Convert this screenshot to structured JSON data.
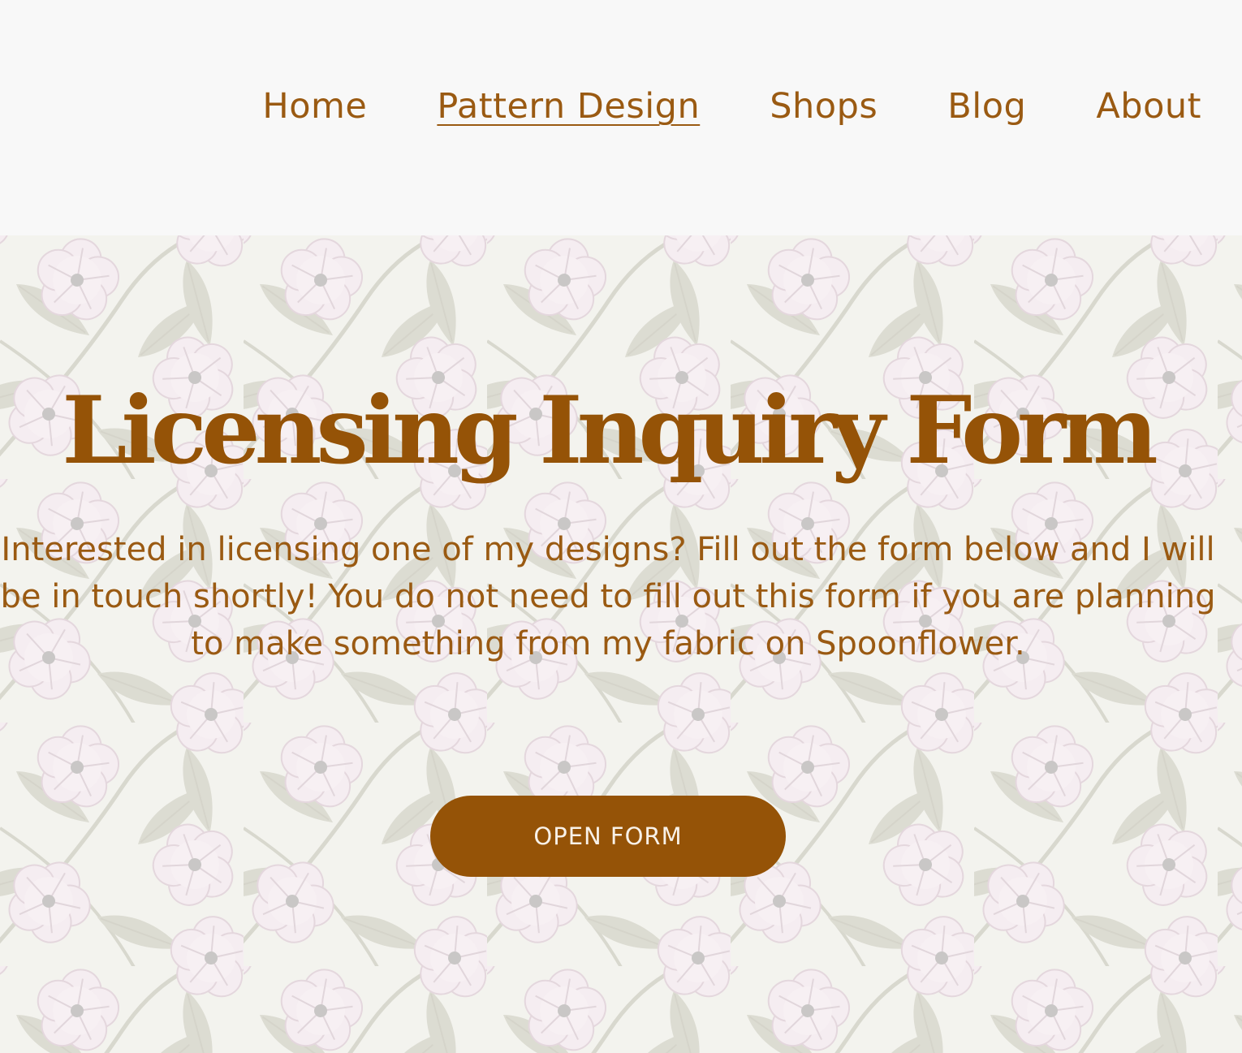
{
  "nav": {
    "items": [
      {
        "label": "Home",
        "active": false
      },
      {
        "label": "Pattern Design",
        "active": true
      },
      {
        "label": "Shops",
        "active": false
      },
      {
        "label": "Blog",
        "active": false
      },
      {
        "label": "About",
        "active": false
      }
    ]
  },
  "hero": {
    "title": "Licensing Inquiry Form",
    "description": "Interested in licensing one of my designs? Fill out the form below and I will be in touch shortly! You do not need to fill out this form if you are planning to make something from my fabric on Spoonflower.",
    "button_label": "OPEN FORM",
    "background": "floral-pattern"
  },
  "colors": {
    "accent": "#955307",
    "header_bg": "#f8f8f8",
    "button_text": "#f8f1e8"
  }
}
